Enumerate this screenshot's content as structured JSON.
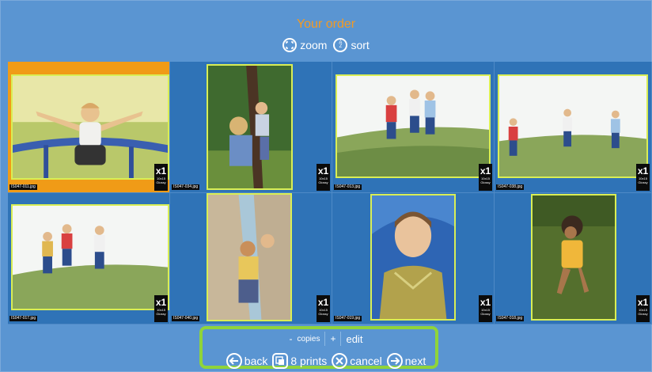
{
  "header": {
    "title": "Your order"
  },
  "toolbar": {
    "zoom_label": "zoom",
    "sort_label": "sort",
    "sort_glyph": "A Z"
  },
  "photos": [
    {
      "filename": "IS047-011.jpg",
      "qty": "x1",
      "size": "10x15 Glossy",
      "selected": true
    },
    {
      "filename": "IS047-034.jpg",
      "qty": "x1",
      "size": "10x15 Glossy"
    },
    {
      "filename": "IS047-013.jpg",
      "qty": "x1",
      "size": "10x15 Glossy"
    },
    {
      "filename": "IS047-038.jpg",
      "qty": "x1",
      "size": "10x15 Glossy"
    },
    {
      "filename": "IS047-017.jpg",
      "qty": "x1",
      "size": "10x15 Glossy"
    },
    {
      "filename": "IS047-040.jpg",
      "qty": "x1",
      "size": "10x15 Glossy"
    },
    {
      "filename": "IS047-019.jpg",
      "qty": "x1",
      "size": "10x15 Glossy"
    },
    {
      "filename": "IS047-018.jpg",
      "qty": "x1",
      "size": "10x15 Glossy"
    }
  ],
  "copies": {
    "minus": "-",
    "label": "copies",
    "plus": "+",
    "edit": "edit"
  },
  "nav": {
    "back": "back",
    "prints": "8 prints",
    "cancel": "cancel",
    "next": "next"
  },
  "colors": {
    "background": "#5a95d2",
    "cell": "#2f73b7",
    "selected": "#f09b17",
    "title": "#f39a23",
    "highlight": "#8fd43a",
    "photo_border": "#d9ee55"
  }
}
